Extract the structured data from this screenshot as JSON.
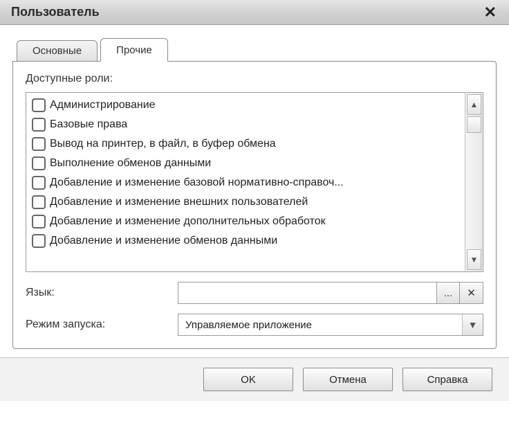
{
  "window": {
    "title": "Пользователь"
  },
  "tabs": [
    {
      "label": "Основные"
    },
    {
      "label": "Прочие"
    }
  ],
  "section": {
    "roles_label": "Доступные роли:"
  },
  "roles": [
    {
      "label": "Администрирование"
    },
    {
      "label": "Базовые права"
    },
    {
      "label": "Вывод на принтер, в файл, в буфер обмена"
    },
    {
      "label": "Выполнение обменов данными"
    },
    {
      "label": "Добавление и изменение базовой нормативно-справоч..."
    },
    {
      "label": "Добавление и изменение внешних пользователей"
    },
    {
      "label": "Добавление и изменение дополнительных обработок"
    },
    {
      "label": "Добавление и изменение обменов данными"
    }
  ],
  "form": {
    "language_label": "Язык:",
    "language_value": "",
    "launch_label": "Режим запуска:",
    "launch_value": "Управляемое приложение"
  },
  "buttons": {
    "ok": "OK",
    "cancel": "Отмена",
    "help": "Справка",
    "ellipsis": "...",
    "clear": "✕"
  }
}
